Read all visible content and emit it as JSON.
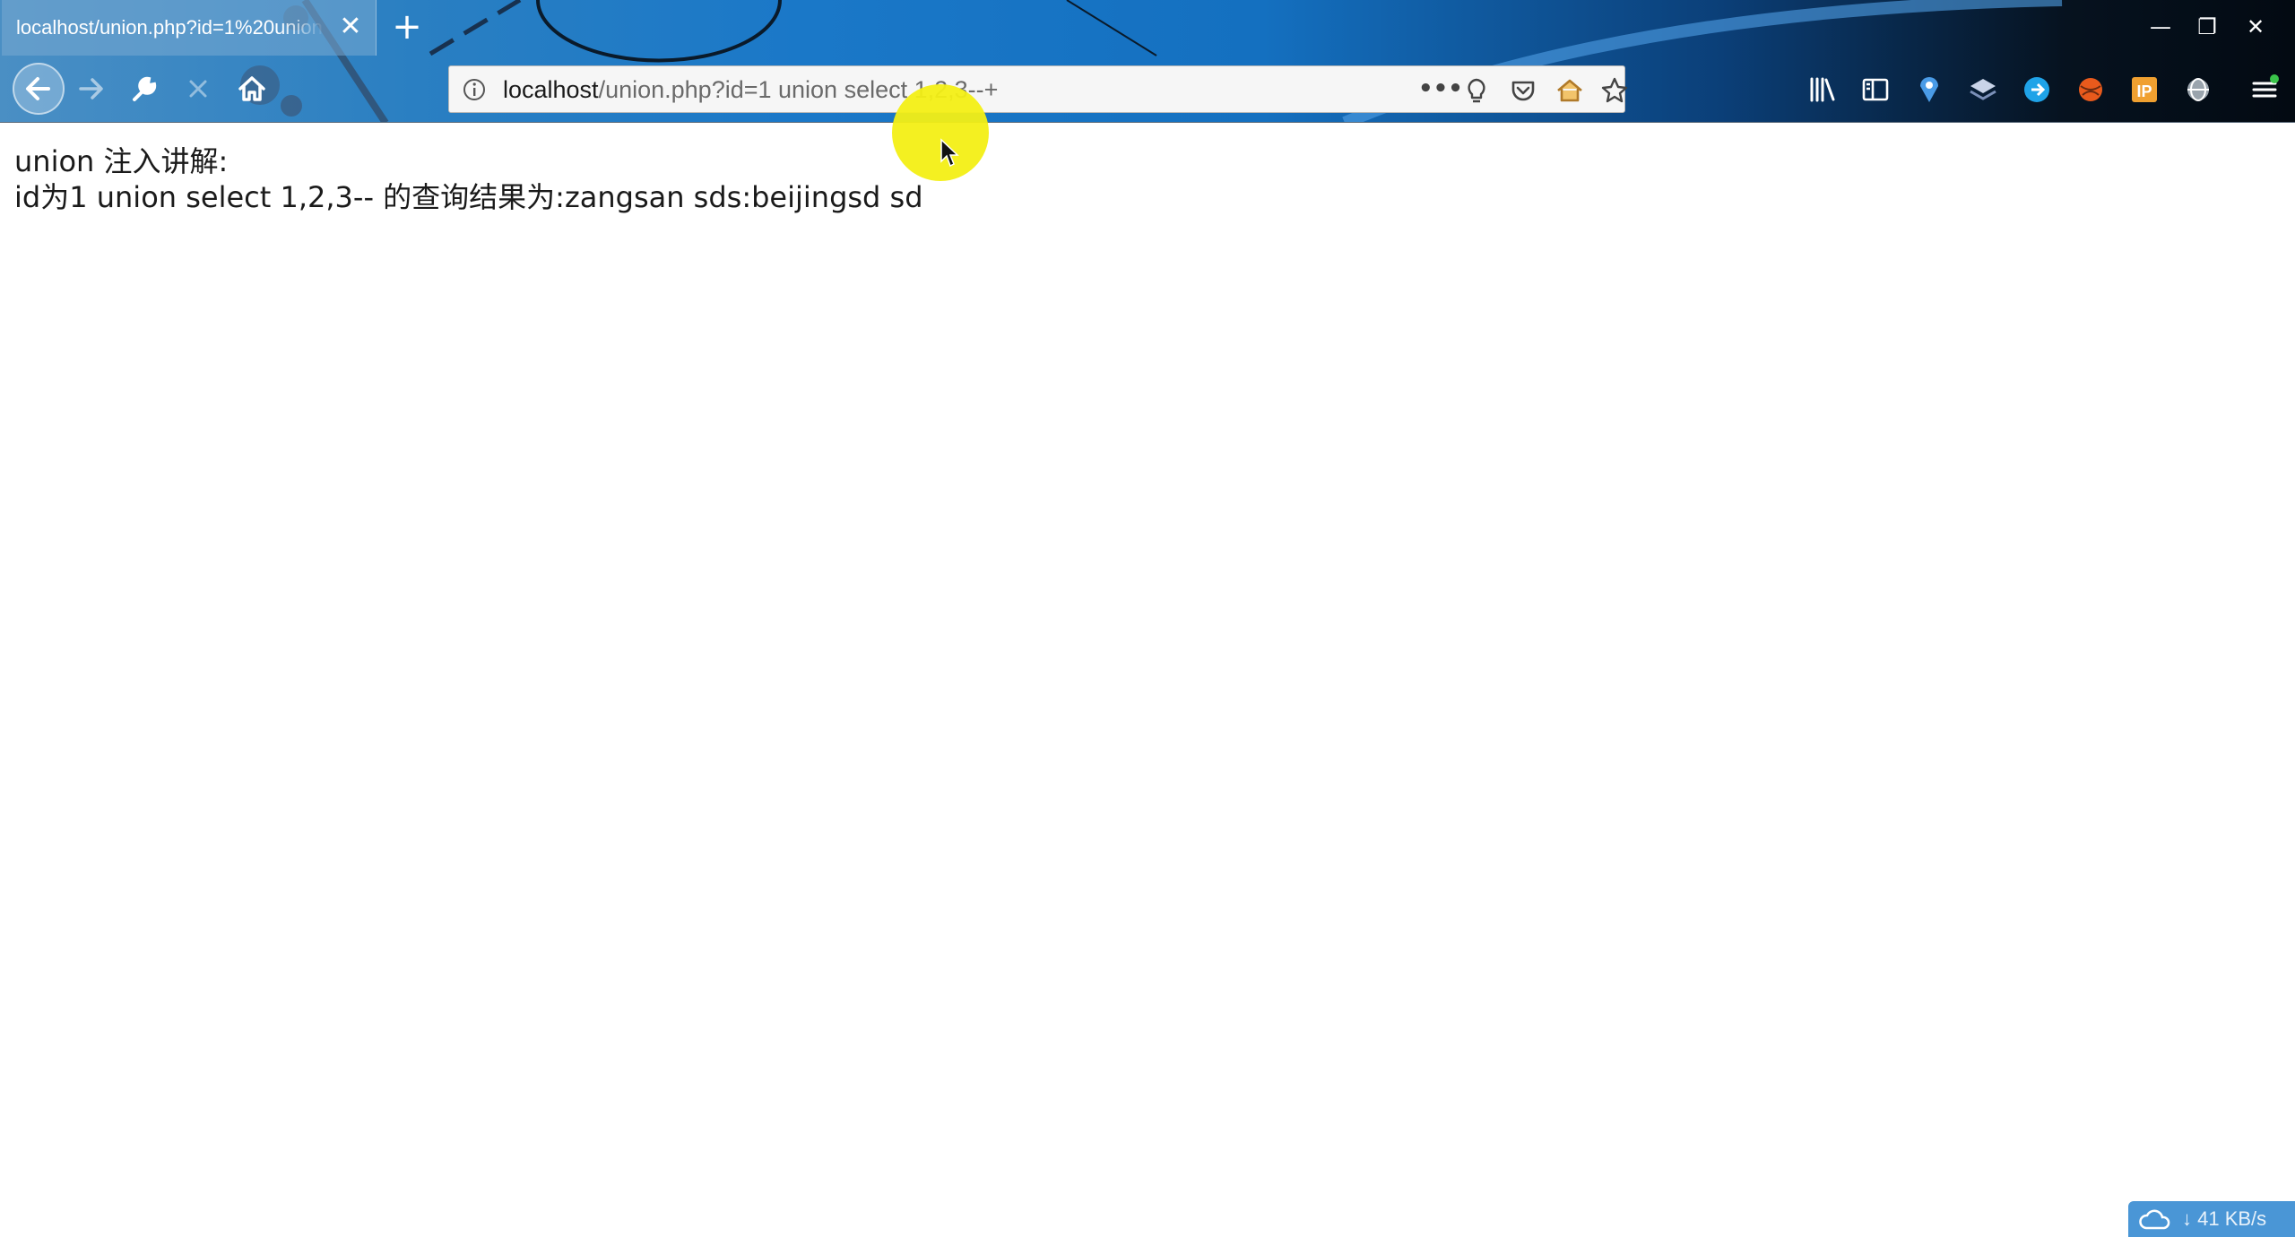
{
  "browser": {
    "tab_title": "localhost/union.php?id=1%20union",
    "tab_close": "✕",
    "new_tab": "+",
    "window_controls": {
      "minimize": "—",
      "restore": "❐",
      "close": "✕"
    }
  },
  "urlbar": {
    "host": "localhost",
    "path": "/union.php?id=1 union select 1,2,3--+",
    "page_actions_icon": "•••"
  },
  "page": {
    "line1": "union 注入讲解:",
    "line2": "id为1 union select 1,2,3-- 的查询结果为:zangsan sds:beijingsd sd"
  },
  "status_overlay": {
    "speed": "41 KB/s"
  },
  "colors": {
    "chrome_accent": "#1a78c8",
    "cursor_halo": "#f3ef15",
    "netspeed_bg": "#4a96d6"
  }
}
